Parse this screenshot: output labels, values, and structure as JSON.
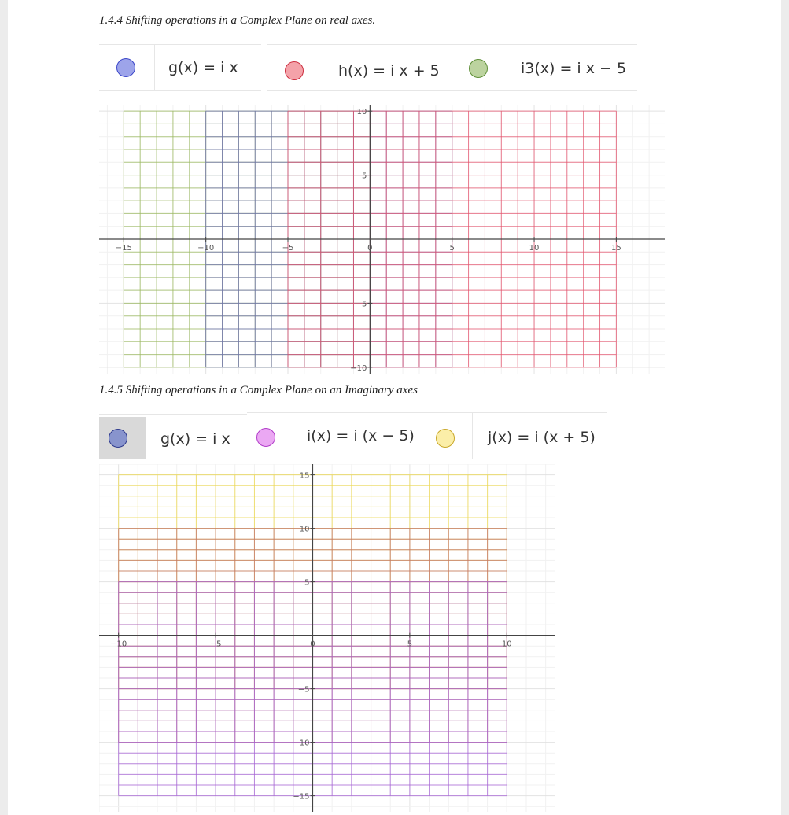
{
  "section1": {
    "heading": "1.4.4 Shifting operations in a Complex Plane on real axes.",
    "functions": [
      {
        "label": "g(x)  =  i x",
        "color": "#9da4ea",
        "border": "#3c47c9",
        "selected": false
      },
      {
        "label": "h(x)  =  i x + 5",
        "color": "#f4a2a9",
        "border": "#cc2e3f",
        "selected": false
      },
      {
        "label": "i3(x)  =  i x − 5",
        "color": "#bcd39f",
        "border": "#5e8f37",
        "selected": false
      }
    ],
    "chart_data": {
      "type": "grid",
      "x_ticks": [
        "−15",
        "−10",
        "−5",
        "0",
        "5",
        "10",
        "15"
      ],
      "y_ticks": [
        "10",
        "5",
        "−5",
        "−10"
      ],
      "xlim": [
        -16.5,
        18
      ],
      "ylim": [
        -10.5,
        10.5
      ],
      "regions": [
        {
          "function": "i3(x) = i x − 5",
          "x_range": [
            -15,
            0
          ],
          "y_range": [
            -10,
            10
          ],
          "color": "#9ab85c"
        },
        {
          "function": "g(x) = i x",
          "x_range": [
            -10,
            5
          ],
          "y_range": [
            -10,
            10
          ],
          "color": "#6d6fb8"
        },
        {
          "function": "h(x) = i x + 5",
          "x_range": [
            -5,
            15
          ],
          "y_range": [
            -10,
            10
          ],
          "color": "#e6506b"
        }
      ]
    }
  },
  "section2": {
    "heading": "1.4.5  Shifting operations in a Complex Plane on an Imaginary axes",
    "functions": [
      {
        "label": "g(x)  =  i x",
        "color": "#8894cd",
        "border": "#2e3a8c",
        "selected": true
      },
      {
        "label": "i(x)  =  i (x − 5)",
        "color": "#eba8f3",
        "border": "#b13cc9",
        "selected": false
      },
      {
        "label": "j(x)  =  i (x + 5)",
        "color": "#fbeea8",
        "border": "#c9a82a",
        "selected": false
      }
    ],
    "chart_data": {
      "type": "grid",
      "x_ticks": [
        "−10",
        "−5",
        "0",
        "5",
        "10"
      ],
      "y_ticks": [
        "15",
        "10",
        "5",
        "−5",
        "−10",
        "−15"
      ],
      "xlim": [
        -11,
        12.5
      ],
      "ylim": [
        -16.5,
        16
      ],
      "regions": [
        {
          "function": "j(x) = i (x + 5)",
          "x_range": [
            -10,
            10
          ],
          "y_range": [
            -5,
            15
          ],
          "color": "#eed84a"
        },
        {
          "function": "g(x) = i x",
          "x_range": [
            -10,
            10
          ],
          "y_range": [
            -10,
            10
          ],
          "color": "#c27070"
        },
        {
          "function": "i(x) = i (x − 5)",
          "x_range": [
            -10,
            10
          ],
          "y_range": [
            -15,
            5
          ],
          "color": "#a562d6"
        }
      ]
    }
  }
}
